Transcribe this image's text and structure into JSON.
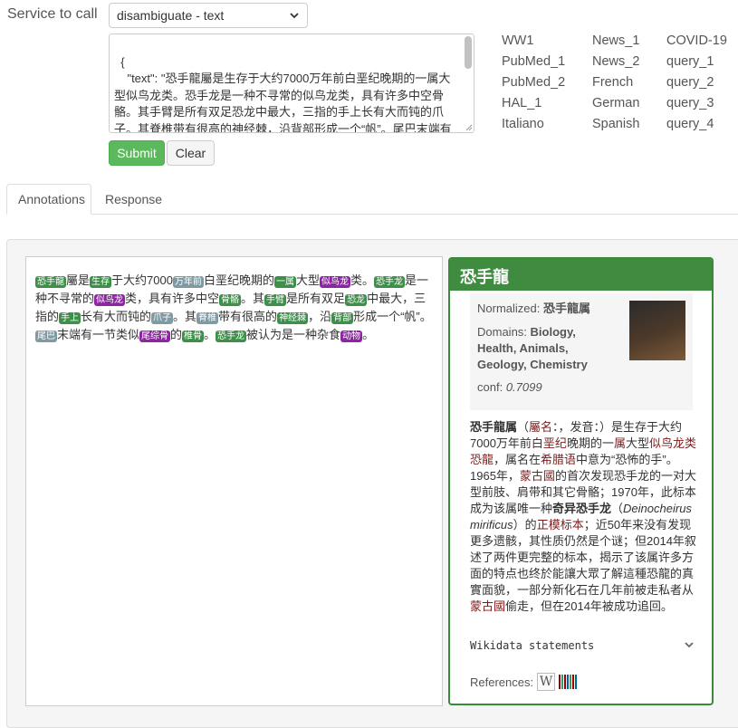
{
  "service": {
    "label": "Service to call",
    "selected": "disambiguate - text"
  },
  "query_text": "{\n    \"text\": \"恐手龍屬是生存于大约7000万年前白垩纪晚期的一属大型似鸟龙类。恐手龙是一种不寻常的似鸟龙类，具有许多中空骨骼。其手臂是所有双足恐龙中最大，三指的手上长有大而钝的爪子。其脊椎带有很高的神经棘，沿背部形成一个“帆”。尾巴末端有一节类似尾综骨的椎骨。恐手龙被认为是一种杂食动物。  \",",
  "buttons": {
    "submit": "Submit",
    "clear": "Clear"
  },
  "samples": [
    [
      "WW1",
      "PubMed_1",
      "PubMed_2",
      "HAL_1",
      "Italiano"
    ],
    [
      "News_1",
      "News_2",
      "French",
      "German",
      "Spanish"
    ],
    [
      "COVID-19",
      "query_1",
      "query_2",
      "query_3",
      "query_4"
    ]
  ],
  "tabs": {
    "annotations": "Annotations",
    "response": "Response"
  },
  "annotated_segments": [
    {
      "t": "恐手龍",
      "c": "green"
    },
    {
      "t": "屬是"
    },
    {
      "t": "生存",
      "c": "green"
    },
    {
      "t": "于大约7000"
    },
    {
      "t": "万年前",
      "c": "slate"
    },
    {
      "t": "白垩纪晚期的"
    },
    {
      "t": "一属",
      "c": "green"
    },
    {
      "t": "大型"
    },
    {
      "t": "似鸟龙",
      "c": "purple"
    },
    {
      "t": "类。"
    },
    {
      "t": "恐手龙",
      "c": "green"
    },
    {
      "t": "是一种不寻常的"
    },
    {
      "t": "似鸟龙",
      "c": "purple"
    },
    {
      "t": "类，具有许多中空"
    },
    {
      "t": "骨骼",
      "c": "green"
    },
    {
      "t": "。其"
    },
    {
      "t": "手臂",
      "c": "green"
    },
    {
      "t": "是所有双足"
    },
    {
      "t": "恐龙",
      "c": "green"
    },
    {
      "t": "中最大，三指的"
    },
    {
      "t": "手上",
      "c": "green"
    },
    {
      "t": "长有大而钝的"
    },
    {
      "t": "爪子",
      "c": "slate"
    },
    {
      "t": "。其"
    },
    {
      "t": "脊椎",
      "c": "slate"
    },
    {
      "t": "带有很高的"
    },
    {
      "t": "神经棘",
      "c": "green"
    },
    {
      "t": "，沿"
    },
    {
      "t": "背部",
      "c": "green"
    },
    {
      "t": "形成一个“帆”。"
    },
    {
      "t": "尾巴",
      "c": "slate"
    },
    {
      "t": "末端有一节类似"
    },
    {
      "t": "尾综骨",
      "c": "purple"
    },
    {
      "t": "的"
    },
    {
      "t": "椎骨",
      "c": "green"
    },
    {
      "t": "。"
    },
    {
      "t": "恐手龙",
      "c": "green"
    },
    {
      "t": "被认为是一种杂食"
    },
    {
      "t": "动物",
      "c": "purple"
    },
    {
      "t": "。"
    }
  ],
  "info": {
    "title": "恐手龍",
    "normalized_label": "Normalized:",
    "normalized_value": "恐手龍属",
    "domains_label": "Domains:",
    "domains_value": "Biology, Health, Animals, Geology, Chemistry",
    "conf_label": "conf:",
    "conf_value": "0.7099",
    "description": [
      {
        "t": "恐手龍属",
        "b": true
      },
      {
        "t": "（"
      },
      {
        "t": "屬名",
        "l": true
      },
      {
        "t": "：，发音：）是生存于大约7000万年前"
      },
      {
        "t": "白垩纪",
        "l": true
      },
      {
        "t": "晚期的一"
      },
      {
        "t": "属",
        "l": true
      },
      {
        "t": "大型"
      },
      {
        "t": "似鸟龙类恐龍",
        "l": true
      },
      {
        "t": "，属名在"
      },
      {
        "t": "希腊语",
        "l": true
      },
      {
        "t": "中意为“恐怖的手”。1965年，"
      },
      {
        "t": "蒙古國",
        "l": true
      },
      {
        "t": "的首次发现恐手龙的一对大型前肢、肩带和其它骨骼；1970年，此标本成为该属唯一种"
      },
      {
        "t": "奇异恐手龙",
        "b": true
      },
      {
        "t": "（"
      },
      {
        "t": "Deinocheirus mirificus",
        "i": true
      },
      {
        "t": "）的"
      },
      {
        "t": "正模标本",
        "l": true
      },
      {
        "t": "；近50年来没有发现更多遗骸，其性质仍然是个谜；但2014年叙述了两件更完整的标本，揭示了该属许多方面的特点也终於能讓大眾了解這種恐龍的真實面貌，一部分新化石在几年前被走私者从"
      },
      {
        "t": "蒙古國",
        "l": true
      },
      {
        "t": "偷走，但在2014年被成功追回。"
      }
    ],
    "wikidata": "Wikidata statements",
    "references": "References:"
  },
  "colors": {
    "green": "#3e8f4a",
    "purple": "#8e26a3",
    "slate": "#7e9aa3",
    "submit": "#5cb85c",
    "panel_border": "#3a8a3a",
    "link": "#7c1c1c"
  }
}
